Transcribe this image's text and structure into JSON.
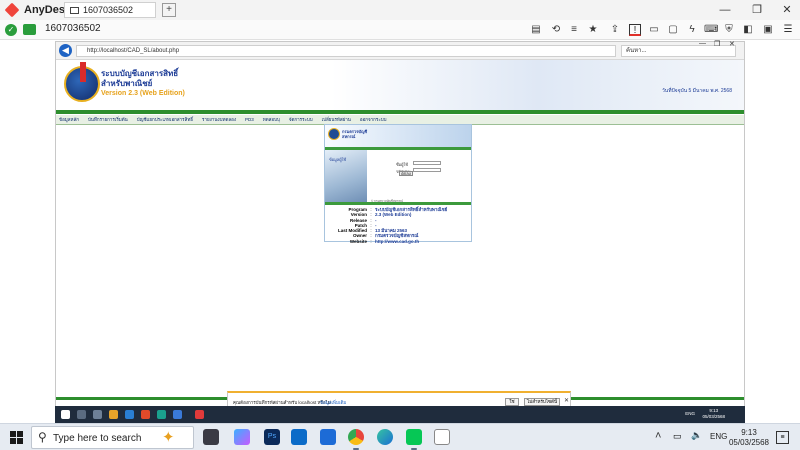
{
  "anydesk": {
    "app_name": "AnyDesk",
    "tab_label": "1607036502",
    "address": "1607036502"
  },
  "browser": {
    "url": "http://localhost/CAD_SL/about.php",
    "search_placeholder": "ค้นหา..."
  },
  "site": {
    "title_line1": "ระบบบัญชีเอกสารสิทธิ์",
    "title_line2": "สำหรับพาณิชย์",
    "version": "Version 2.3 (Web Edition)",
    "date": "วันที่ปัจจุบัน 5 มีนาคม พ.ศ. 2568",
    "nav": [
      "ข้อมูลหลัก",
      "บันทึกรายการเริ่มต้น",
      "บัญชีแยกประเภทเอกสารสิทธิ์",
      "รายงานงบทดลอง",
      "PD3",
      "ทดสอบบุ",
      "จัดการระบบ",
      "เปลี่ยนรหัสผ่าน",
      "ออกจากระบบ"
    ]
  },
  "login": {
    "brand_line1": "กรมตรวจบัญชี",
    "brand_line2": "สหกรณ์",
    "photo_label": "ข้อมูลผู้ใช้",
    "username_label": "ชื่อผู้ใช้",
    "password_label": "รหัสผ่าน",
    "button": "ตกลง",
    "footnote": "© กรมตรวจบัญชีสหกรณ์"
  },
  "about": [
    {
      "key": "Program",
      "value": "ระบบบัญชีเอกสารสิทธิ์สำหรับพาณิชย์"
    },
    {
      "key": "Version",
      "value": "2.3 (Web Edition)"
    },
    {
      "key": "Release",
      "value": "-"
    },
    {
      "key": "Patch",
      "value": "-"
    },
    {
      "key": "Last Modified",
      "value": "13 มีนาคม 2563"
    },
    {
      "key": "Owner",
      "value": "กรมตรวจบัญชีสหกรณ์"
    },
    {
      "key": "Website",
      "value": "http://www.cad.go.th"
    }
  ],
  "notification": {
    "text": "คุณต้องการบันทึกรหัสผ่านสำหรับ localhost หรือไม่",
    "link": "ข้อมูลเพิ่มเติม",
    "yes": "ใช่",
    "no": "ไม่สำหรับไซต์นี้"
  },
  "remote_taskbar": {
    "lang": "ENG",
    "time": "9:13",
    "date": "05/03/2568"
  },
  "taskbar": {
    "search_placeholder": "Type here to search",
    "lang": "ENG",
    "time": "9:13",
    "date": "05/03/2568"
  },
  "colors": {
    "accent_green": "#2d8e2d",
    "brand_blue": "#1d3c96",
    "anydesk_red": "#ef443b"
  }
}
